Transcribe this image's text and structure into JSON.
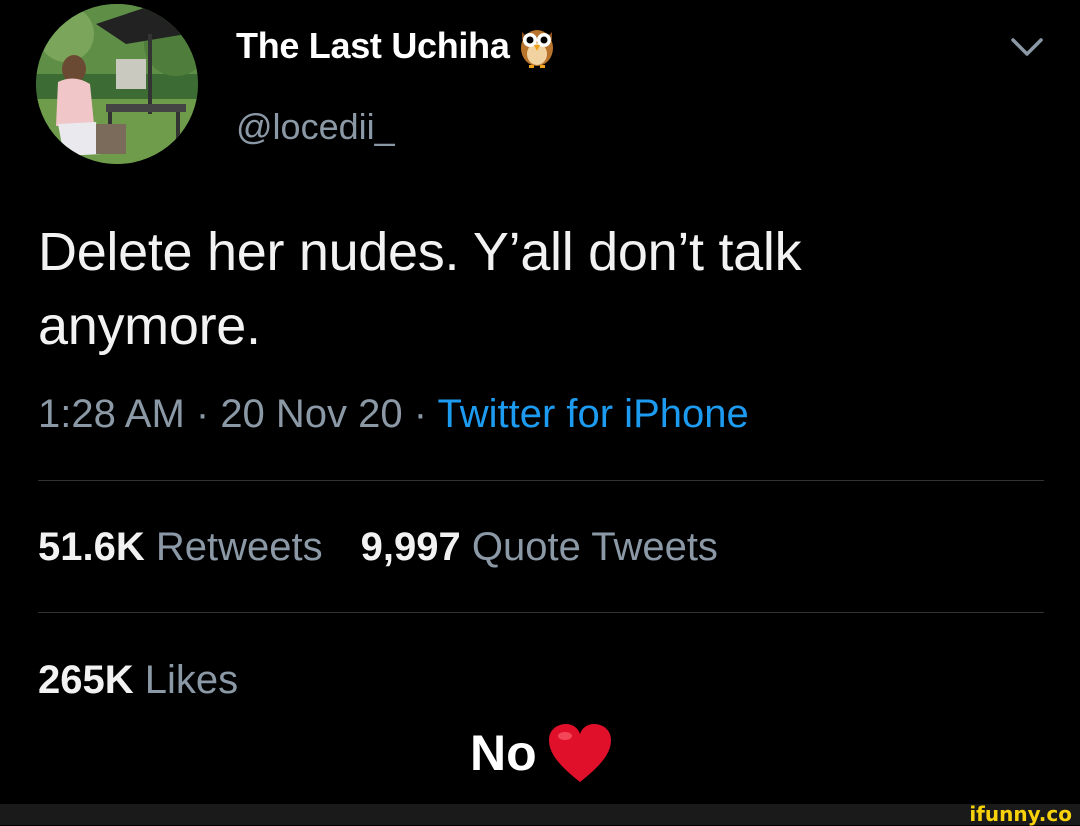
{
  "profile": {
    "display_name": "The Last Uchiha",
    "name_emoji_icon": "owl-icon",
    "handle": "@locedii_",
    "avatar_icon": "profile-photo",
    "menu_icon": "chevron-down-icon"
  },
  "tweet": {
    "text": "Delete her nudes. Y’all don’t talk anymore.",
    "time": "1:28 AM",
    "separator": " · ",
    "date": "20 Nov 20",
    "source": "Twitter for iPhone"
  },
  "stats": {
    "retweets_count": "51.6K",
    "retweets_label": "Retweets",
    "quotes_count": "9,997",
    "quotes_label": "Quote Tweets",
    "likes_count": "265K",
    "likes_label": "Likes"
  },
  "caption": {
    "text": "No",
    "emoji_icon": "heart-icon"
  },
  "watermark": {
    "text": "ifunny.co"
  },
  "colors": {
    "background": "#000000",
    "primary_text": "#f2f2f2",
    "secondary_text": "#8b98a5",
    "link": "#1d9bf0",
    "divider": "#2f3336",
    "heart": "#e0102a",
    "watermark": "#f7d20b"
  }
}
